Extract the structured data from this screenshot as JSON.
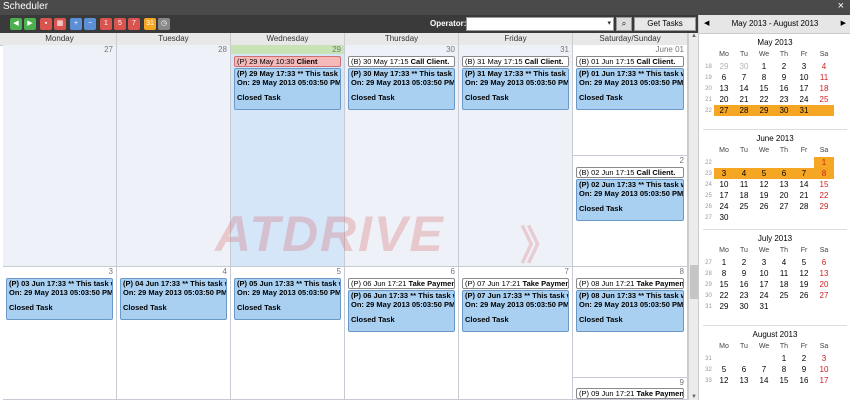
{
  "window": {
    "title": "Scheduler",
    "close": "×"
  },
  "toolbar": {
    "icons": [
      {
        "name": "go-back-icon",
        "color": "#4caf50",
        "glyph": "◀"
      },
      {
        "name": "go-forward-icon",
        "color": "#4caf50",
        "glyph": "▶"
      },
      {
        "name": "today-icon",
        "color": "#d9534f",
        "glyph": "▪"
      },
      {
        "name": "calendar-icon",
        "color": "#d9534f",
        "glyph": "▦"
      },
      {
        "name": "zoom-in-icon",
        "color": "#5b8fd6",
        "glyph": "+"
      },
      {
        "name": "zoom-out-icon",
        "color": "#5b8fd6",
        "glyph": "−"
      },
      {
        "name": "day-view-icon",
        "color": "#d9534f",
        "glyph": "1"
      },
      {
        "name": "work-week-view-icon",
        "color": "#d9534f",
        "glyph": "5"
      },
      {
        "name": "week-view-icon",
        "color": "#d9534f",
        "glyph": "7"
      },
      {
        "name": "month-view-icon",
        "color": "#f5a623",
        "glyph": "31"
      },
      {
        "name": "timeline-view-icon",
        "color": "#888888",
        "glyph": "◷"
      }
    ],
    "operator_label": "Operator:",
    "operator_value": "",
    "dropdown_arrow": "▾",
    "search_glyph": "⌕",
    "get_tasks_label": "Get Tasks"
  },
  "day_headers": [
    "Monday",
    "Tuesday",
    "Wednesday",
    "Thursday",
    "Friday",
    "Saturday/Sunday"
  ],
  "week1": {
    "dates": [
      "27",
      "28",
      "29",
      "30",
      "31",
      "June 01"
    ],
    "sunday_date": "2",
    "wed_appts": [
      {
        "kind": "pink",
        "prefix": "(P) 29 May 10:30 ",
        "title": "Client"
      },
      {
        "kind": "blue",
        "line1": "(P) 29 May 17:33 ** This task was",
        "line2": "On: 29 May 2013 05:03:50 PM *",
        "line3": "Closed Task"
      }
    ],
    "thu_appts": [
      {
        "kind": "white",
        "prefix": "(B) 30 May 17:15 ",
        "title": "Call Client."
      },
      {
        "kind": "blue",
        "line1": "(P) 30 May 17:33 ** This task was",
        "line2": "On: 29 May 2013 05:03:50 PM *",
        "line3": "Closed Task"
      }
    ],
    "fri_appts": [
      {
        "kind": "white",
        "prefix": "(B) 31 May 17:15 ",
        "title": "Call Client."
      },
      {
        "kind": "blue",
        "line1": "(P) 31 May 17:33 ** This task was",
        "line2": "On: 29 May 2013 05:03:50 PM *",
        "line3": "Closed Task"
      }
    ],
    "sat_appts": [
      {
        "kind": "white",
        "prefix": "(B) 01 Jun 17:15 ",
        "title": "Call Client."
      },
      {
        "kind": "blue",
        "line1": "(P) 01 Jun 17:33 ** This task was",
        "line2": "On: 29 May 2013 05:03:50 PM *",
        "line3": "Closed Task"
      }
    ],
    "sun_appts": [
      {
        "kind": "white",
        "prefix": "(B) 02 Jun 17:15 ",
        "title": "Call Client."
      },
      {
        "kind": "blue",
        "line1": "(P) 02 Jun 17:33 ** This task was",
        "line2": "On: 29 May 2013 05:03:50 PM *",
        "line3": "Closed Task"
      }
    ]
  },
  "week2": {
    "dates": [
      "3",
      "4",
      "5",
      "6",
      "7",
      "8"
    ],
    "sunday_date": "9",
    "mon": {
      "line1": "(P) 03 Jun 17:33 ** This task was",
      "line2": "On: 29 May 2013 05:03:50 PM *",
      "line3": "Closed Task"
    },
    "tue": {
      "line1": "(P) 04 Jun 17:33 ** This task was",
      "line2": "On: 29 May 2013 05:03:50 PM *",
      "line3": "Closed Task"
    },
    "wed": {
      "line1": "(P) 05 Jun 17:33 ** This task was",
      "line2": "On: 29 May 2013 05:03:50 PM *",
      "line3": "Closed Task"
    },
    "thu_white": {
      "prefix": "(P) 06 Jun 17:21 ",
      "title": "Take Payment"
    },
    "thu": {
      "line1": "(P) 06 Jun 17:33 ** This task was",
      "line2": "On: 29 May 2013 05:03:50 PM *",
      "line3": "Closed Task"
    },
    "fri_white": {
      "prefix": "(P) 07 Jun 17:21 ",
      "title": "Take Payment"
    },
    "fri": {
      "line1": "(P) 07 Jun 17:33 ** This task was",
      "line2": "On: 29 May 2013 05:03:50 PM *",
      "line3": "Closed Task"
    },
    "sat_white": {
      "prefix": "(P) 08 Jun 17:21 ",
      "title": "Take Payment"
    },
    "sat": {
      "line1": "(P) 08 Jun 17:33 ** This task was",
      "line2": "On: 29 May 2013 05:03:50 PM *",
      "line3": "Closed Task"
    },
    "sun_white": {
      "prefix": "(P) 09 Jun 17:21 ",
      "title": "Take Payment"
    }
  },
  "watermark": {
    "text": "ATDRIVE",
    "arrows": "》"
  },
  "scrollbar": {
    "up": "▲",
    "down": "▼"
  },
  "calendar": {
    "range_label": "May 2013 - August 2013",
    "prev": "◀",
    "next": "▶",
    "weekdays": [
      "Mo",
      "Tu",
      "We",
      "Th",
      "Fr",
      "Sa"
    ],
    "months": [
      {
        "title": "May 2013",
        "weeks": [
          {
            "wk": "18",
            "days": [
              {
                "d": "29",
                "o": true
              },
              {
                "d": "30",
                "o": true
              },
              {
                "d": "1"
              },
              {
                "d": "2"
              },
              {
                "d": "3"
              },
              {
                "d": "4",
                "r": true
              }
            ]
          },
          {
            "wk": "19",
            "days": [
              {
                "d": "6"
              },
              {
                "d": "7"
              },
              {
                "d": "8"
              },
              {
                "d": "9"
              },
              {
                "d": "10"
              },
              {
                "d": "11",
                "r": true
              }
            ]
          },
          {
            "wk": "20",
            "days": [
              {
                "d": "13"
              },
              {
                "d": "14"
              },
              {
                "d": "15"
              },
              {
                "d": "16"
              },
              {
                "d": "17"
              },
              {
                "d": "18",
                "r": true
              }
            ]
          },
          {
            "wk": "21",
            "days": [
              {
                "d": "20"
              },
              {
                "d": "21"
              },
              {
                "d": "22"
              },
              {
                "d": "23"
              },
              {
                "d": "24"
              },
              {
                "d": "25",
                "r": true
              }
            ]
          },
          {
            "wk": "22",
            "days": [
              {
                "d": "27",
                "h": true
              },
              {
                "d": "28",
                "h": true
              },
              {
                "d": "29",
                "h": true
              },
              {
                "d": "30",
                "h": true
              },
              {
                "d": "31",
                "h": true
              },
              {
                "d": "",
                "h": true
              }
            ]
          }
        ]
      },
      {
        "title": "June 2013",
        "weeks": [
          {
            "wk": "22",
            "days": [
              {
                "d": ""
              },
              {
                "d": ""
              },
              {
                "d": ""
              },
              {
                "d": ""
              },
              {
                "d": ""
              },
              {
                "d": "1",
                "r": true,
                "h": true
              }
            ]
          },
          {
            "wk": "23",
            "days": [
              {
                "d": "3",
                "h": true
              },
              {
                "d": "4",
                "h": true
              },
              {
                "d": "5",
                "h": true
              },
              {
                "d": "6",
                "h": true
              },
              {
                "d": "7",
                "h": true
              },
              {
                "d": "8",
                "r": true,
                "h": true
              }
            ]
          },
          {
            "wk": "24",
            "days": [
              {
                "d": "10"
              },
              {
                "d": "11"
              },
              {
                "d": "12"
              },
              {
                "d": "13"
              },
              {
                "d": "14"
              },
              {
                "d": "15",
                "r": true
              }
            ]
          },
          {
            "wk": "25",
            "days": [
              {
                "d": "17"
              },
              {
                "d": "18"
              },
              {
                "d": "19"
              },
              {
                "d": "20"
              },
              {
                "d": "21"
              },
              {
                "d": "22",
                "r": true
              }
            ]
          },
          {
            "wk": "26",
            "days": [
              {
                "d": "24"
              },
              {
                "d": "25"
              },
              {
                "d": "26"
              },
              {
                "d": "27"
              },
              {
                "d": "28"
              },
              {
                "d": "29",
                "r": true
              }
            ]
          }
        ]
      },
      {
        "title": "July 2013",
        "weeks": [
          {
            "wk": "27",
            "days": [
              {
                "d": "1"
              },
              {
                "d": "2"
              },
              {
                "d": "3"
              },
              {
                "d": "4"
              },
              {
                "d": "5"
              },
              {
                "d": "6",
                "r": true
              }
            ]
          },
          {
            "wk": "28",
            "days": [
              {
                "d": "8"
              },
              {
                "d": "9"
              },
              {
                "d": "10"
              },
              {
                "d": "11"
              },
              {
                "d": "12"
              },
              {
                "d": "13",
                "r": true
              }
            ]
          },
          {
            "wk": "29",
            "days": [
              {
                "d": "15"
              },
              {
                "d": "16"
              },
              {
                "d": "17"
              },
              {
                "d": "18"
              },
              {
                "d": "19"
              },
              {
                "d": "20",
                "r": true
              }
            ]
          },
          {
            "wk": "30",
            "days": [
              {
                "d": "22"
              },
              {
                "d": "23"
              },
              {
                "d": "24"
              },
              {
                "d": "25"
              },
              {
                "d": "26"
              },
              {
                "d": "27",
                "r": true
              }
            ]
          },
          {
            "wk": "31",
            "days": [
              {
                "d": "29"
              },
              {
                "d": "30"
              },
              {
                "d": "31"
              },
              {
                "d": ""
              },
              {
                "d": ""
              },
              {
                "d": ""
              }
            ]
          }
        ]
      },
      {
        "title": "August 2013",
        "weeks": [
          {
            "wk": "31",
            "days": [
              {
                "d": ""
              },
              {
                "d": ""
              },
              {
                "d": ""
              },
              {
                "d": "1"
              },
              {
                "d": "2"
              },
              {
                "d": "3",
                "r": true
              }
            ]
          },
          {
            "wk": "32",
            "days": [
              {
                "d": "5"
              },
              {
                "d": "6"
              },
              {
                "d": "7"
              },
              {
                "d": "8"
              },
              {
                "d": "9"
              },
              {
                "d": "10",
                "r": true
              }
            ]
          },
          {
            "wk": "33",
            "days": [
              {
                "d": "12"
              },
              {
                "d": "13"
              },
              {
                "d": "14"
              },
              {
                "d": "15"
              },
              {
                "d": "16"
              },
              {
                "d": "17",
                "r": true
              }
            ]
          }
        ]
      }
    ],
    "june_extra": {
      "wk": "23",
      "d": "9",
      "h": true
    },
    "june_last": {
      "wk": "27",
      "d": "30"
    }
  }
}
